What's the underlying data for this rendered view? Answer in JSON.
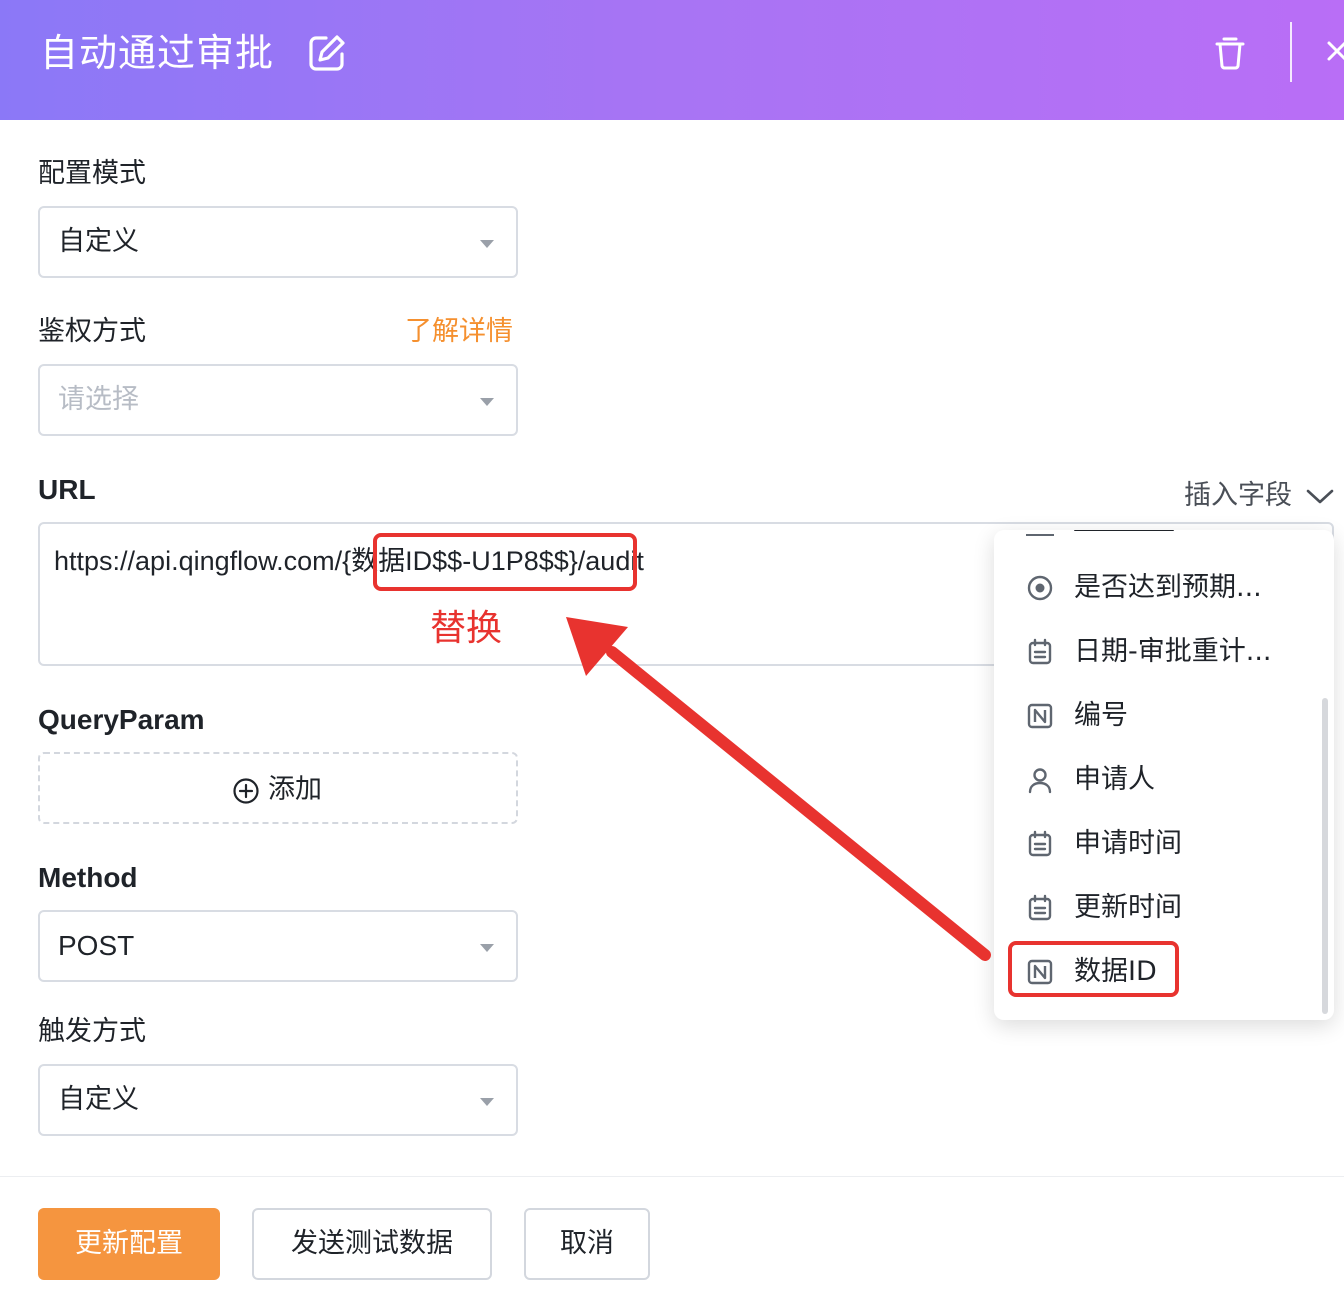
{
  "header": {
    "title": "自动通过审批",
    "icons": [
      "edit-icon",
      "trash-icon",
      "close-icon"
    ]
  },
  "form": {
    "config_mode": {
      "label": "配置模式",
      "value": "自定义"
    },
    "auth_method": {
      "label": "鉴权方式",
      "help_link": "了解详情",
      "placeholder": "请选择"
    },
    "url": {
      "label": "URL",
      "insert_field": "插入字段",
      "value": "https://api.qingflow.com/{数据ID$$-U1P8$$}/audit"
    },
    "query_param": {
      "label": "QueryParam",
      "add_label": "添加"
    },
    "method": {
      "label": "Method",
      "value": "POST"
    },
    "trigger_mode": {
      "label": "触发方式",
      "value": "自定义"
    }
  },
  "annotation": {
    "replace_label": "替换",
    "color": "#e8332f"
  },
  "field_dropdown": {
    "items": [
      {
        "label": "是否达到预期...",
        "icon": "radio-icon"
      },
      {
        "label": "日期-审批重计...",
        "icon": "calendar-icon"
      },
      {
        "label": "编号",
        "icon": "number-field-icon"
      },
      {
        "label": "申请人",
        "icon": "user-icon"
      },
      {
        "label": "申请时间",
        "icon": "calendar-icon"
      },
      {
        "label": "更新时间",
        "icon": "calendar-icon"
      },
      {
        "label": "数据ID",
        "icon": "number-field-icon"
      }
    ]
  },
  "footer": {
    "update_button": "更新配置",
    "test_button": "发送测试数据",
    "cancel_button": "取消"
  },
  "colors": {
    "header_gradient_start": "#8b78f7",
    "header_gradient_end": "#b96ef6",
    "accent_orange": "#f5953f",
    "link_orange": "#f5902f"
  }
}
